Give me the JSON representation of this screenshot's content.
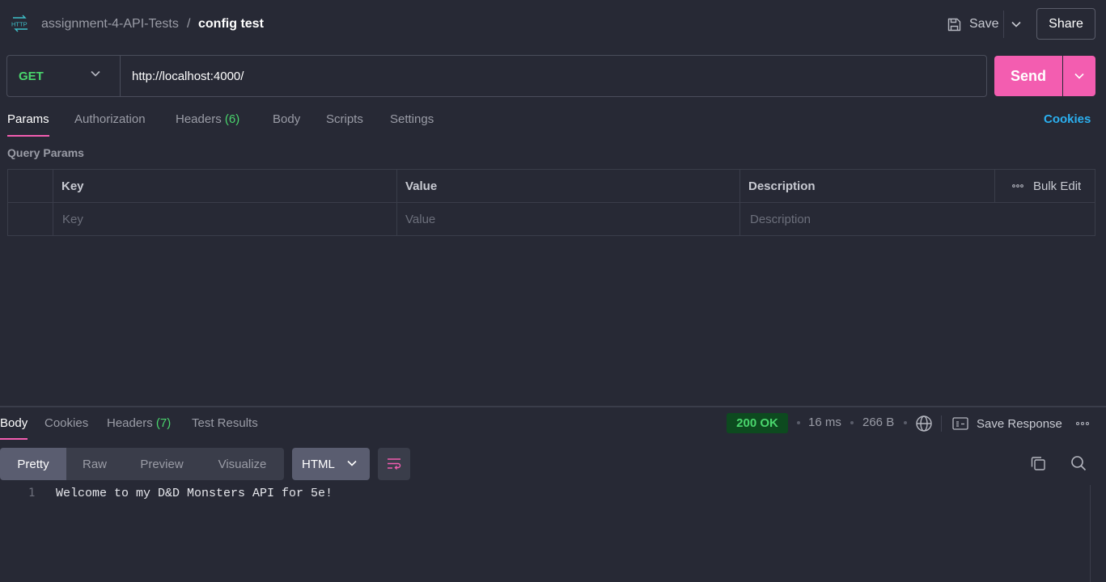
{
  "header": {
    "icon_label": "HTTP",
    "collection": "assignment-4-API-Tests",
    "separator": "/",
    "request_name": "config test",
    "save_label": "Save",
    "share_label": "Share"
  },
  "request": {
    "method": "GET",
    "url": "http://localhost:4000/",
    "send_label": "Send"
  },
  "request_tabs": [
    {
      "label": "Params",
      "count": ""
    },
    {
      "label": "Authorization",
      "count": ""
    },
    {
      "label": "Headers",
      "count": "(6)"
    },
    {
      "label": "Body",
      "count": ""
    },
    {
      "label": "Scripts",
      "count": ""
    },
    {
      "label": "Settings",
      "count": ""
    }
  ],
  "cookies_link": "Cookies",
  "query_params": {
    "title": "Query Params",
    "columns": [
      "Key",
      "Value",
      "Description"
    ],
    "bulk_edit": "Bulk Edit",
    "placeholders": {
      "key": "Key",
      "value": "Value",
      "description": "Description"
    }
  },
  "response": {
    "tabs": [
      {
        "label": "Body",
        "count": ""
      },
      {
        "label": "Cookies",
        "count": ""
      },
      {
        "label": "Headers",
        "count": "(7)"
      },
      {
        "label": "Test Results",
        "count": ""
      }
    ],
    "status": "200 OK",
    "time": "16 ms",
    "size": "266 B",
    "save_response": "Save Response",
    "views": [
      "Pretty",
      "Raw",
      "Preview",
      "Visualize"
    ],
    "format": "HTML",
    "lines": [
      {
        "number": "1",
        "text": "Welcome to my D&D Monsters API for 5e!"
      }
    ]
  },
  "colors": {
    "accent": "#f35db0",
    "method_get": "#4ad66d",
    "link": "#2bb0f0",
    "background": "#272935"
  }
}
